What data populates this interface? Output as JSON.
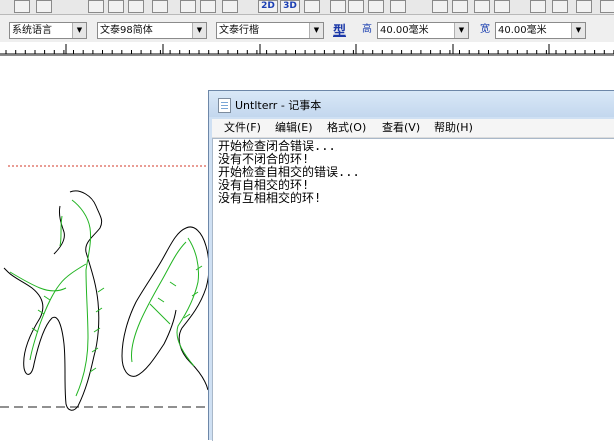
{
  "format_bar": {
    "language_combo": "系统语言",
    "font_combo": "文泰98简体",
    "style_combo": "文泰行楷",
    "type_button": "型",
    "height_label": "高",
    "height_value": "40.00毫米",
    "width_label": "宽",
    "width_value": "40.00毫米"
  },
  "toolbar": {
    "btn_2d": "2D",
    "btn_3d": "3D"
  },
  "notepad": {
    "title": "Untlterr - 记事本",
    "menu": [
      "文件(F)",
      "编辑(E)",
      "格式(O)",
      "查看(V)",
      "帮助(H)"
    ],
    "lines": [
      "开始检查闭合错误...",
      "没有不闭合的环!",
      "开始检查自相交的错误...",
      "没有自相交的环!",
      "没有互相相交的环!"
    ]
  },
  "colors": {
    "outline": "#000000",
    "skeleton": "#22b422",
    "guide_red": "#d33a2a",
    "notepad_frame": "#cfe0f3"
  }
}
